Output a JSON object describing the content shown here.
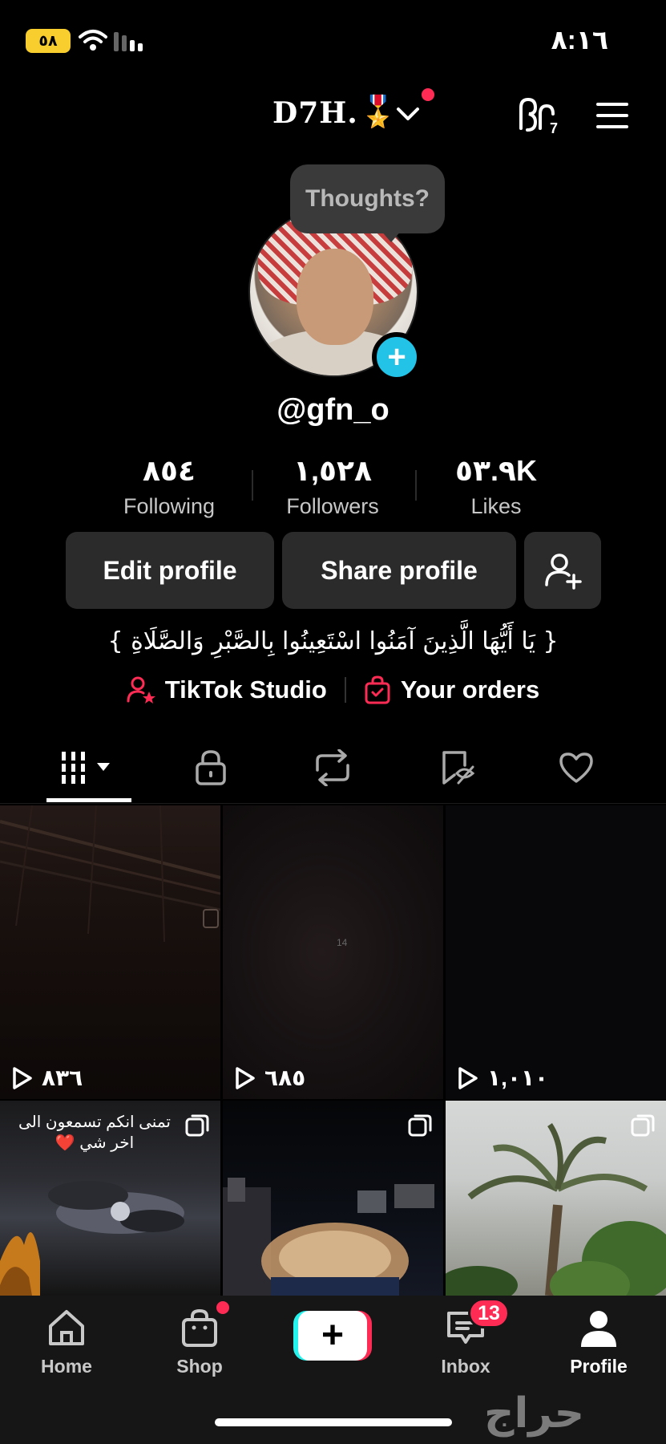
{
  "status_bar": {
    "time": "٨:١٦",
    "battery": "٥٨"
  },
  "header": {
    "display_name": "D7H.",
    "medal": "🎖️"
  },
  "profile": {
    "bubble": "Thoughts?",
    "username": "@gfn_o",
    "stats": [
      {
        "value": "٨٥٤",
        "label": "Following"
      },
      {
        "value": "١,٥٢٨",
        "label": "Followers"
      },
      {
        "value": "٥٣.٩K",
        "label": "Likes"
      }
    ],
    "edit_button": "Edit profile",
    "share_button": "Share profile",
    "bio": "{ يَا أَيُّهَا الَّذِينَ آمَنُوا اسْتَعِينُوا بِالصَّبْرِ وَالصَّلَاةِ }",
    "links": {
      "studio": "TikTok Studio",
      "orders": "Your orders"
    }
  },
  "grid": {
    "videos": [
      {
        "views": "٨٣٦"
      },
      {
        "views": "٦٨٥",
        "overlay": "14"
      },
      {
        "views": "١,٠١٠"
      }
    ],
    "row2_caption": "تمنى انكم تسمعون الى اخر شي ❤️"
  },
  "nav": {
    "home": "Home",
    "shop": "Shop",
    "inbox": "Inbox",
    "inbox_badge": "13",
    "profile": "Profile"
  },
  "watermark": "حراج",
  "colors": {
    "accent_red": "#fe2c55",
    "accent_cyan": "#25f4ee",
    "plus_badge": "#23c3e8"
  }
}
